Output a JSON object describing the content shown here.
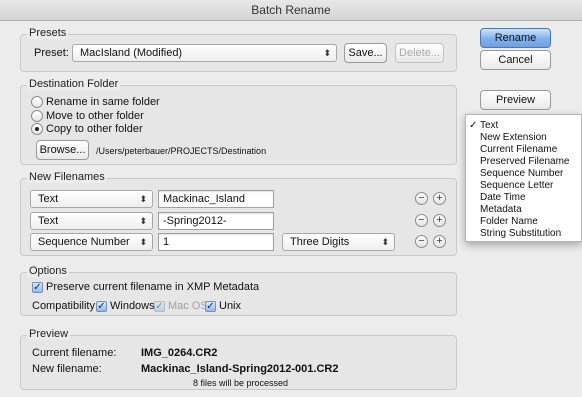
{
  "window": {
    "title": "Batch Rename"
  },
  "presets": {
    "group_label": "Presets",
    "preset_label": "Preset:",
    "selected": "MacIsland (Modified)",
    "save_label": "Save...",
    "delete_label": "Delete..."
  },
  "actions": {
    "rename_label": "Rename",
    "cancel_label": "Cancel",
    "preview_label": "Preview"
  },
  "destination": {
    "group_label": "Destination Folder",
    "options": [
      "Rename in same folder",
      "Move to other folder",
      "Copy to other folder"
    ],
    "selected_index": 2,
    "browse_label": "Browse...",
    "path": "/Users/peterbauer/PROJECTS/Destination"
  },
  "new_filenames": {
    "group_label": "New Filenames",
    "rows": [
      {
        "type": "Text",
        "value": "Mackinac_Island"
      },
      {
        "type": "Text",
        "value": "-Spring2012-"
      },
      {
        "type": "Sequence Number",
        "value": "1",
        "extra": "Three Digits"
      }
    ]
  },
  "options": {
    "group_label": "Options",
    "preserve_label": "Preserve current filename in XMP Metadata",
    "preserve_checked": true,
    "compatibility_label": "Compatibility:",
    "windows_label": "Windows",
    "windows_checked": true,
    "macos_label": "Mac OS",
    "macos_checked": true,
    "unix_label": "Unix",
    "unix_checked": true
  },
  "preview": {
    "group_label": "Preview",
    "current_label": "Current filename:",
    "current_value": "IMG_0264.CR2",
    "new_label": "New filename:",
    "new_value": "Mackinac_Island-Spring2012-001.CR2",
    "files_note": "8 files will be processed"
  },
  "dropdown_menu": {
    "items": [
      "Text",
      "New Extension",
      "Current Filename",
      "Preserved Filename",
      "Sequence Number",
      "Sequence Letter",
      "Date Time",
      "Metadata",
      "Folder Name",
      "String Substitution"
    ],
    "checked_index": 0,
    "check_glyph": "✓"
  },
  "glyphs": {
    "select_arrows": "⬍",
    "minus": "−",
    "plus": "+",
    "checkmark": "✓"
  }
}
